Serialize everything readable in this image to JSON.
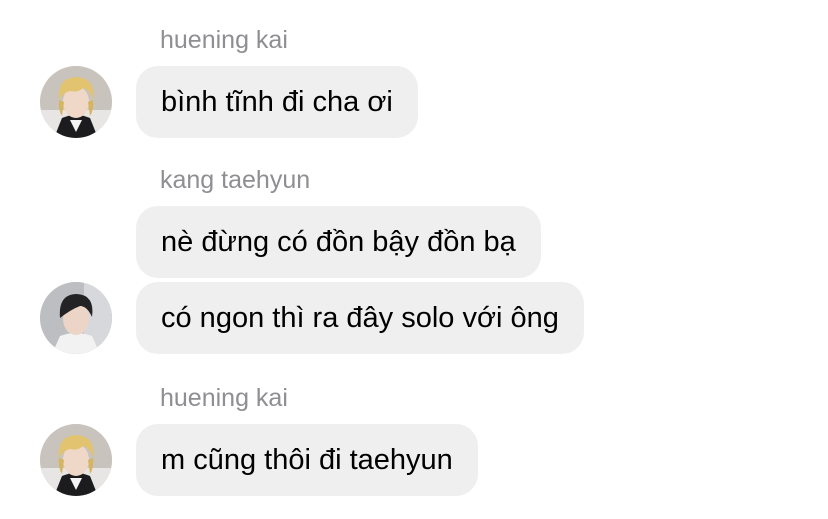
{
  "messages": [
    {
      "sender": "huening kai",
      "texts": [
        "bình tĩnh đi cha ơi"
      ],
      "avatar": "blond-hair-avatar"
    },
    {
      "sender": "kang taehyun",
      "texts": [
        "nè đừng có đồn bậy đồn bạ",
        "có ngon thì ra đây solo với ông"
      ],
      "avatar": "dark-hair-avatar"
    },
    {
      "sender": "huening kai",
      "texts": [
        "m cũng thôi đi taehyun"
      ],
      "avatar": "blond-hair-avatar"
    }
  ],
  "colors": {
    "bubble": "#efeff0",
    "sender_name": "#8e8e93",
    "message_text": "#000000",
    "background": "#ffffff"
  }
}
